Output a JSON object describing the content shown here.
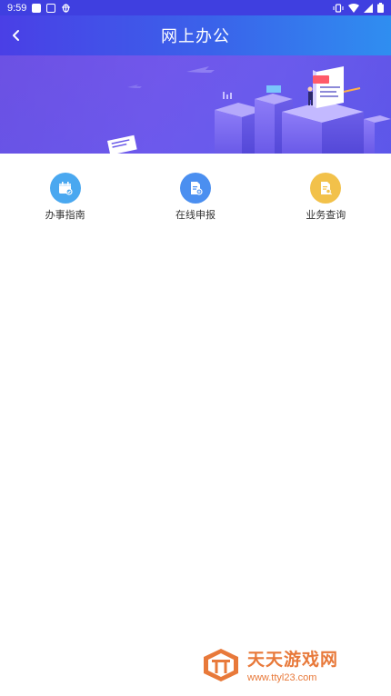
{
  "status_bar": {
    "time": "9:59",
    "icons": [
      "notification-square-icon",
      "image-icon",
      "bug-icon",
      "vibrate-icon",
      "wifi-icon",
      "signal-icon",
      "battery-icon"
    ]
  },
  "app_bar": {
    "title": "网上办公",
    "back_icon": "chevron-left-icon"
  },
  "banner": {
    "illustration": "office-building-isometric"
  },
  "quick_actions": [
    {
      "label": "办事指南",
      "icon": "calendar-check-icon",
      "color": "#4aa8f0"
    },
    {
      "label": "在线申报",
      "icon": "document-submit-icon",
      "color": "#4b8ff0"
    },
    {
      "label": "业务查询",
      "icon": "document-search-icon",
      "color": "#f2c14a"
    }
  ],
  "watermark": {
    "title": "天天游戏网",
    "url": "www.ttyl23.com",
    "logo": "tt-logo"
  },
  "colors": {
    "app_bar_start": "#4a3fe6",
    "app_bar_end": "#2f8ef0",
    "watermark_orange": "#e8793a"
  }
}
